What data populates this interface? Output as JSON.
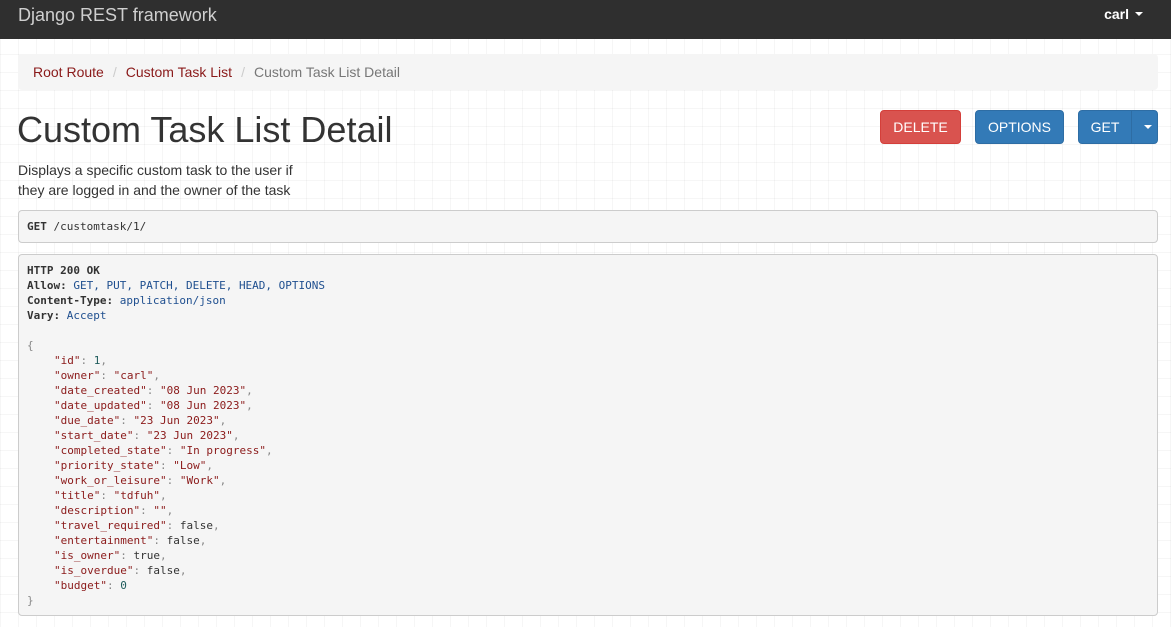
{
  "navbar": {
    "brand": "Django REST framework",
    "user": "carl"
  },
  "breadcrumb": {
    "items": [
      "Root Route",
      "Custom Task List"
    ],
    "active": "Custom Task List Detail",
    "separator": "/"
  },
  "page": {
    "title": "Custom Task List Detail",
    "description_line1": "Displays a specific custom task to the user if",
    "description_line2": "they are logged in and the owner of the task"
  },
  "buttons": {
    "delete": "DELETE",
    "options": "OPTIONS",
    "get": "GET"
  },
  "request": {
    "method": "GET",
    "path": "/customtask/1/"
  },
  "response": {
    "status": "HTTP 200 OK",
    "headers": [
      {
        "key": "Allow",
        "value": "GET, PUT, PATCH, DELETE, HEAD, OPTIONS"
      },
      {
        "key": "Content-Type",
        "value": "application/json"
      },
      {
        "key": "Vary",
        "value": "Accept"
      }
    ],
    "body": [
      {
        "key": "id",
        "type": "number",
        "value": "1"
      },
      {
        "key": "owner",
        "type": "string",
        "value": "carl"
      },
      {
        "key": "date_created",
        "type": "string",
        "value": "08 Jun 2023"
      },
      {
        "key": "date_updated",
        "type": "string",
        "value": "08 Jun 2023"
      },
      {
        "key": "due_date",
        "type": "string",
        "value": "23 Jun 2023"
      },
      {
        "key": "start_date",
        "type": "string",
        "value": "23 Jun 2023"
      },
      {
        "key": "completed_state",
        "type": "string",
        "value": "In progress"
      },
      {
        "key": "priority_state",
        "type": "string",
        "value": "Low"
      },
      {
        "key": "work_or_leisure",
        "type": "string",
        "value": "Work"
      },
      {
        "key": "title",
        "type": "string",
        "value": "tdfuh"
      },
      {
        "key": "description",
        "type": "string",
        "value": ""
      },
      {
        "key": "travel_required",
        "type": "bool",
        "value": "false"
      },
      {
        "key": "entertainment",
        "type": "bool",
        "value": "false"
      },
      {
        "key": "is_owner",
        "type": "bool",
        "value": "true"
      },
      {
        "key": "is_overdue",
        "type": "bool",
        "value": "false"
      },
      {
        "key": "budget",
        "type": "number",
        "value": "0"
      }
    ]
  }
}
